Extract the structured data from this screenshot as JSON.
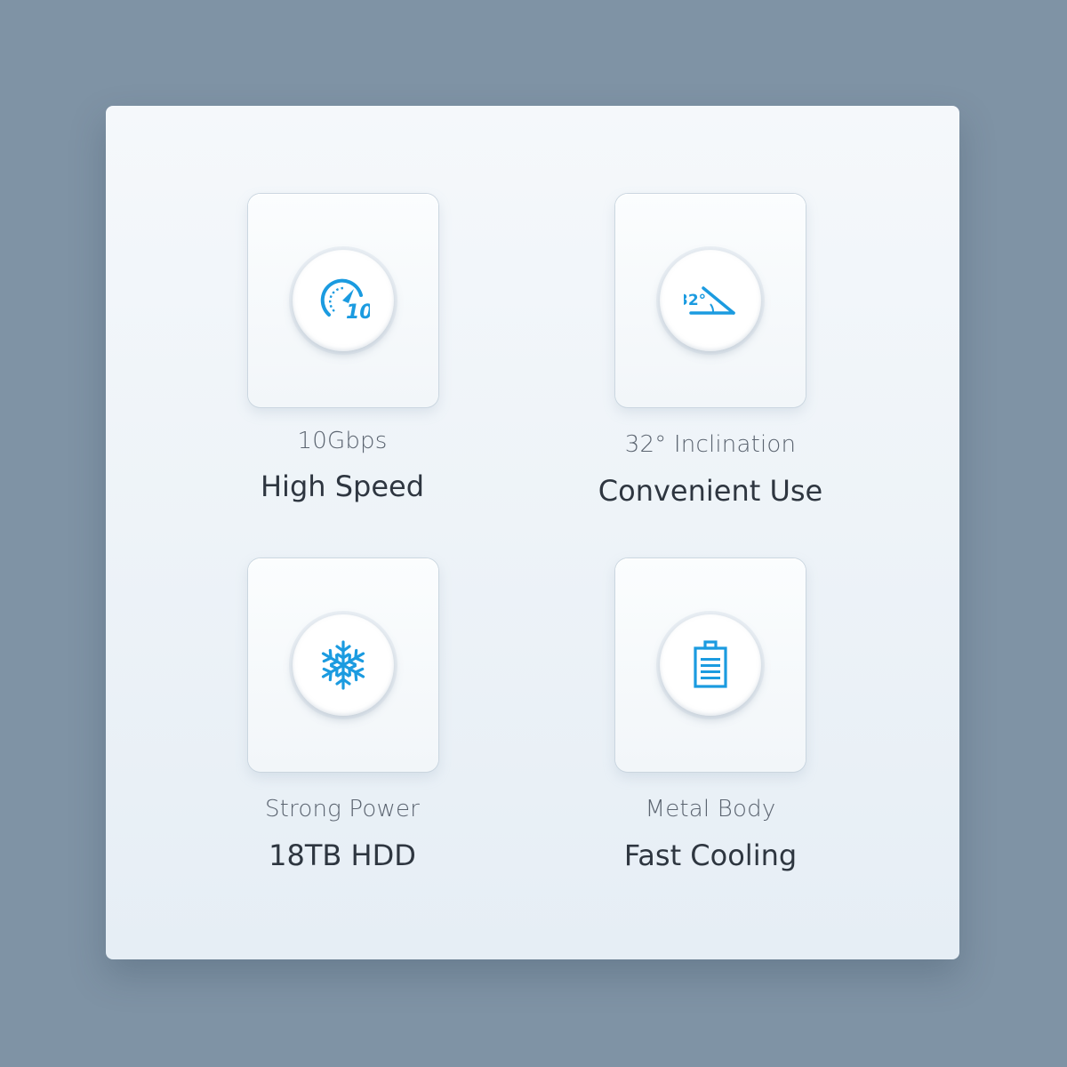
{
  "colors": {
    "background": "#7f93a5",
    "accent": "#1b9be0",
    "text_primary": "#2e3640",
    "text_secondary": "#5b6470"
  },
  "features": [
    {
      "icon": "speedometer-icon",
      "icon_text": "10",
      "subtitle": "10Gbps",
      "title": "High Speed"
    },
    {
      "icon": "inclination-angle-icon",
      "icon_text": "32°",
      "subtitle": "32° Inclination",
      "title": "Convenient Use"
    },
    {
      "icon": "snowflake-icon",
      "subtitle": "Strong Power",
      "title": "18TB HDD"
    },
    {
      "icon": "battery-icon",
      "subtitle": "Metal Body",
      "title": "Fast Cooling"
    }
  ]
}
